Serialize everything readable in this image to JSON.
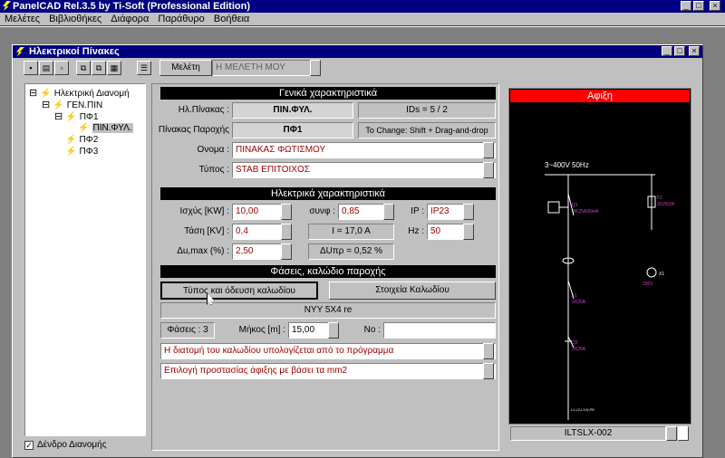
{
  "app": {
    "title": "PanelCAD Rel.3.5 by Ti-Soft  (Professional Edition)"
  },
  "menu": [
    "Μελέτες",
    "Βιβλιοθήκες",
    "Διάφορα",
    "Παράθυρο",
    "Βοήθεια"
  ],
  "window": {
    "title": "Ηλεκτρικοί Πίνακες"
  },
  "toolbar": {
    "study_label": "Μελέτη",
    "study_value": "Η ΜΕΛΕΤΗ ΜΟΥ"
  },
  "tree": {
    "root": "Ηλεκτρική Διανομή",
    "n1": "ΓΕΝ.ΠΙΝ",
    "n2": "ΠΦ1",
    "n3": "ΠΙΝ.ΦΥΛ.",
    "n4": "ΠΦ2",
    "n5": "ΠΦ3",
    "checkbox_label": "Δένδρο Διανομής"
  },
  "general": {
    "header": "Γενικά χαρακτηριστικά",
    "panel_label": "Ηλ.Πίνακας :",
    "panel_value": "ΠΙΝ.ΦΥΛ.",
    "ids": "IDs = 5 / 2",
    "supply_label": "Πίνακας Παροχής",
    "supply_value": "ΠΦ1",
    "change_hint": "To Change: Shift + Drag-and-drop",
    "name_label": "Ονομα :",
    "name_value": "ΠΙΝΑΚΑΣ ΦΩΤΙΣΜΟΥ",
    "type_label": "Τύπος :",
    "type_value": "STAB ΕΠΙΤΟΙΧΟΣ"
  },
  "electrical": {
    "header": "Ηλεκτρικά χαρακτηριστικά",
    "power_label": "Ισχύς [KW] :",
    "power_value": "10,00",
    "cos_label": "συνφ :",
    "cos_value": "0,85",
    "ip_label": "IP :",
    "ip_value": "IP23",
    "voltage_label": "Τάση [KV] :",
    "voltage_value": "0,4",
    "current": "I = 17,0 A",
    "hz_label": "Hz :",
    "hz_value": "50",
    "du_label": "Δu,max (%) :",
    "du_value": "2,50",
    "dupr": "ΔUπρ = 0,52 %"
  },
  "phases": {
    "header": "Φάσεις, καλώδιο παροχής",
    "btn_type": "Τύπος και όδευση καλωδίου",
    "btn_cable": "Στοιχεία Καλωδίου",
    "cable": "NYY 5X4 re",
    "phases_label": "Φάσεις : 3",
    "length_label": "Μήκος [m] :",
    "length_value": "15,00",
    "no_label": "No :",
    "no_value": "",
    "dd1": "Η διατομή του καλωδίου υπολογίζεται από το πρόγραμμα",
    "dd2": "Επιλογή προστασίας άφιξης με βάσει τα mm2"
  },
  "diagram": {
    "header": "Αφιξη",
    "supply": "3~400V 50Hz",
    "q1a": "Q1",
    "q1b": "ΦΚ25A30mA",
    "f1a": "F1",
    "f1b": "3X25A",
    "x1a": "X1",
    "x1b": "230V",
    "fu1a": "F2",
    "fu1b": "3X25/2A",
    "q2a": "Q2",
    "q2b": "3X25A",
    "cablecode": "L1,L2,L3,N,PE",
    "footer": "ILTSLX-002"
  },
  "colors": {
    "titlebar": "#000080",
    "diagram_header": "#ff0000",
    "field_text": "#a00000"
  }
}
